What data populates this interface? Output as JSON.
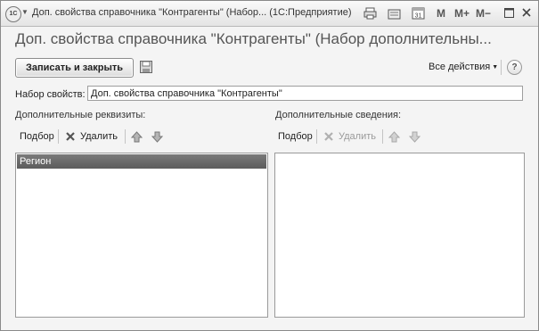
{
  "window": {
    "title": "Доп. свойства справочника \"Контрагенты\" (Набор... (1С:Предприятие)",
    "toolbar": {
      "m_label": "M",
      "mplus_label": "M+",
      "mminus_label": "M−",
      "calendar_day": "31"
    }
  },
  "form": {
    "header": "Доп. свойства справочника \"Контрагенты\" (Набор дополнительны...",
    "save_close_label": "Записать и закрыть",
    "all_actions_label": "Все действия",
    "help_label": "?",
    "property_set_label": "Набор свойств:",
    "property_set_value": "Доп. свойства справочника \"Контрагенты\""
  },
  "left_panel": {
    "label": "Дополнительные реквизиты:",
    "pick_label": "Подбор",
    "delete_label": "Удалить",
    "rows": [
      "Регион"
    ]
  },
  "right_panel": {
    "label": "Дополнительные сведения:",
    "pick_label": "Подбор",
    "delete_label": "Удалить",
    "rows": []
  }
}
